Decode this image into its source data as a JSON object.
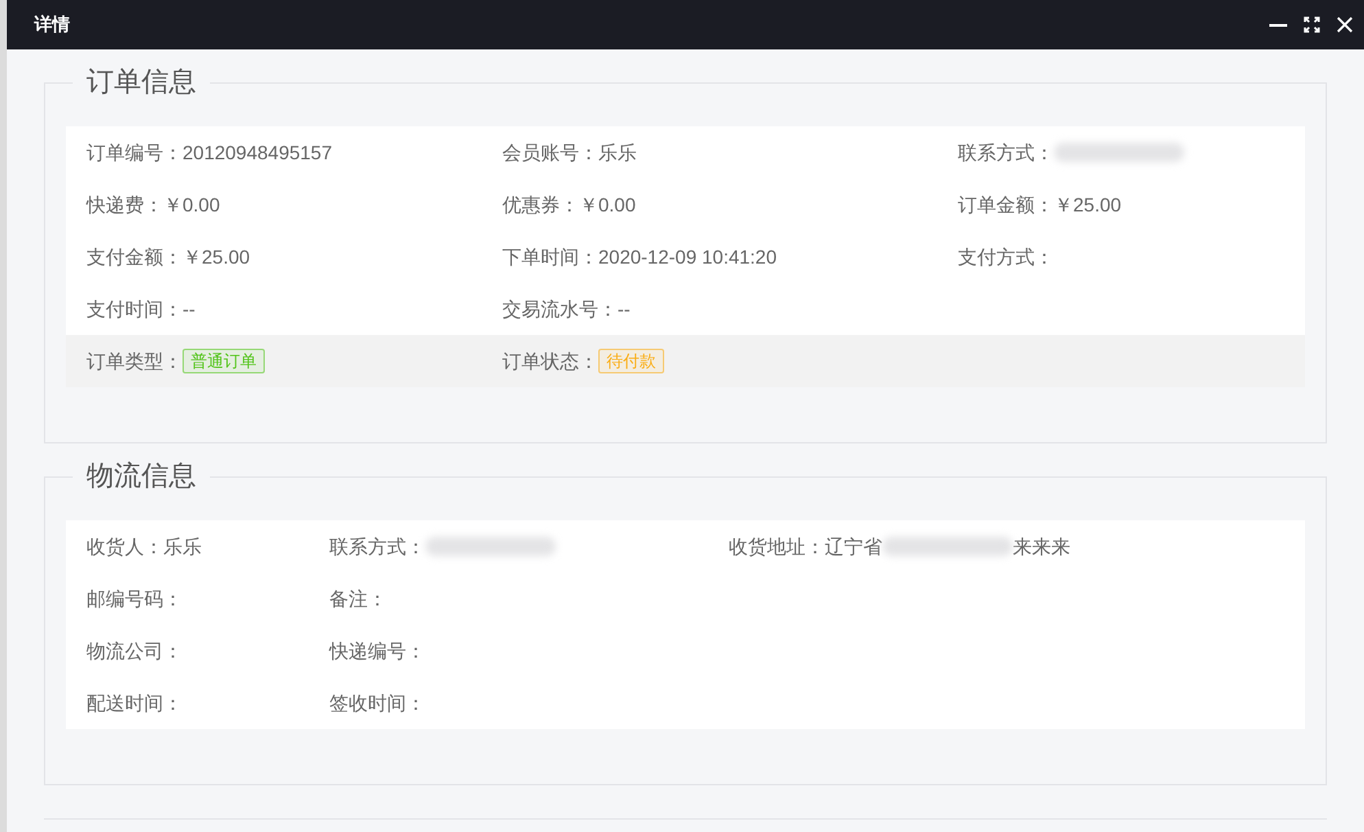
{
  "window": {
    "title": "详情"
  },
  "sections": [
    {
      "title": "订单信息",
      "rows": [
        {
          "shaded": false,
          "fields": [
            {
              "kind": "text",
              "label": "订单编号：",
              "value": "20120948495157"
            },
            {
              "kind": "text",
              "label": "会员账号：",
              "value": "乐乐"
            },
            {
              "kind": "redacted",
              "label": "联系方式："
            }
          ]
        },
        {
          "shaded": false,
          "fields": [
            {
              "kind": "text",
              "label": "快递费：",
              "value": "￥0.00"
            },
            {
              "kind": "text",
              "label": "优惠券：",
              "value": "￥0.00"
            },
            {
              "kind": "text",
              "label": "订单金额：",
              "value": "￥25.00"
            }
          ]
        },
        {
          "shaded": false,
          "fields": [
            {
              "kind": "text",
              "label": "支付金额：",
              "value": "￥25.00"
            },
            {
              "kind": "text",
              "label": "下单时间：",
              "value": "2020-12-09 10:41:20"
            },
            {
              "kind": "text",
              "label": "支付方式："
            }
          ]
        },
        {
          "shaded": false,
          "fields": [
            {
              "kind": "text",
              "label": "支付时间：",
              "value": "--"
            },
            {
              "kind": "text",
              "label": "交易流水号：",
              "value": "--"
            }
          ]
        },
        {
          "shaded": true,
          "fields": [
            {
              "kind": "tag",
              "label": "订单类型：",
              "value": "普通订单",
              "color": "#52c41a"
            },
            {
              "kind": "tag",
              "label": "订单状态：",
              "value": "待付款",
              "color": "#faad14"
            }
          ]
        }
      ]
    },
    {
      "title": "物流信息",
      "rows": [
        {
          "shaded": false,
          "fields": [
            {
              "kind": "text",
              "label": "收货人：",
              "value": "乐乐"
            },
            {
              "kind": "redacted",
              "label": "联系方式："
            },
            {
              "kind": "mixed",
              "label": "收货地址：",
              "parts": [
                {
                  "kind": "text",
                  "text": "辽宁省"
                },
                {
                  "kind": "redacted"
                },
                {
                  "kind": "text",
                  "text": "来来来"
                }
              ]
            }
          ]
        },
        {
          "shaded": false,
          "fields": [
            {
              "kind": "text",
              "label": "邮编号码："
            },
            {
              "kind": "text",
              "label": "备注："
            }
          ]
        },
        {
          "shaded": false,
          "fields": [
            {
              "kind": "text",
              "label": "物流公司："
            },
            {
              "kind": "text",
              "label": "快递编号："
            }
          ]
        },
        {
          "shaded": false,
          "fields": [
            {
              "kind": "text",
              "label": "配送时间："
            },
            {
              "kind": "text",
              "label": "签收时间："
            }
          ]
        }
      ]
    }
  ]
}
